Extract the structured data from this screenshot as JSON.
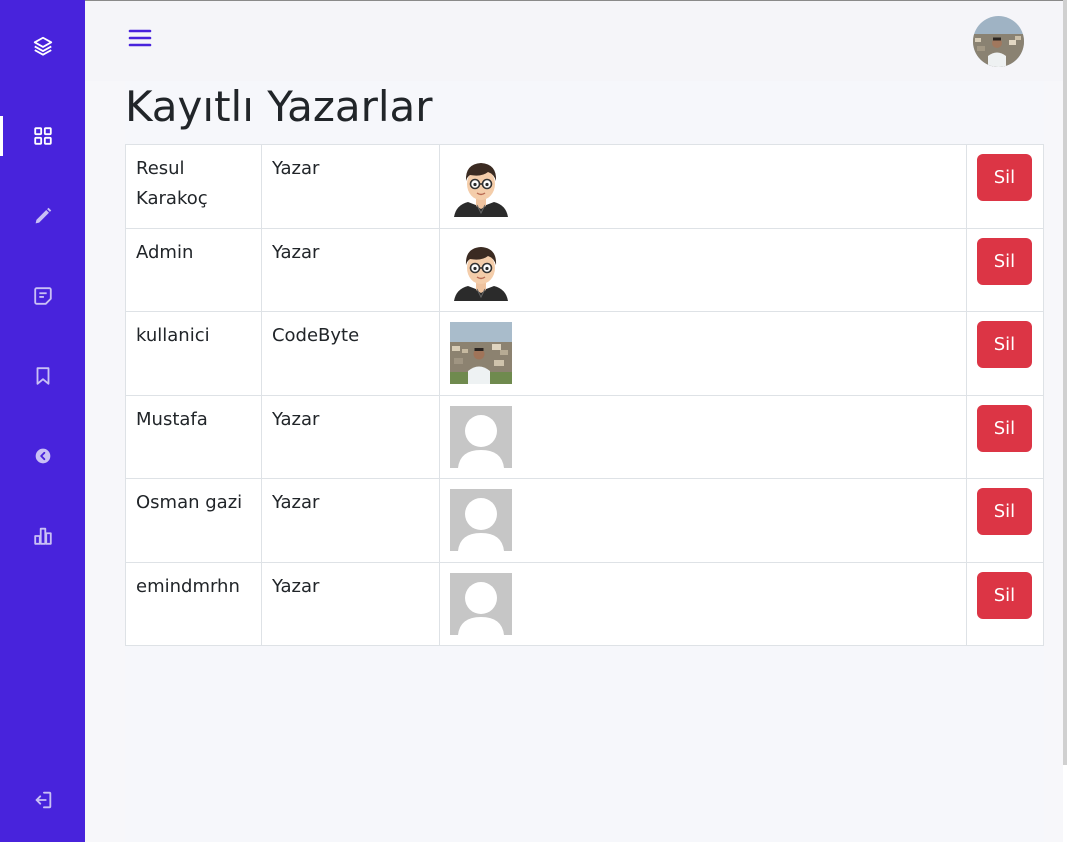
{
  "page": {
    "title": "Kayıtlı Yazarlar"
  },
  "sidebar": {
    "items": [
      {
        "icon": "layers-icon"
      },
      {
        "icon": "grid-icon",
        "active": true
      },
      {
        "icon": "pencil-icon"
      },
      {
        "icon": "note-icon"
      },
      {
        "icon": "bookmark-icon"
      },
      {
        "icon": "arrow-left-circle-icon"
      },
      {
        "icon": "bar-chart-icon"
      },
      {
        "icon": "logout-icon"
      }
    ]
  },
  "topbar": {
    "menu_icon": "hamburger-icon",
    "avatar": "user-avatar"
  },
  "colors": {
    "sidebar": "#4823dc",
    "accent": "#4823dc",
    "danger": "#dc3545"
  },
  "authors": [
    {
      "name": "Resul Karakoç",
      "role": "Yazar",
      "image": "cartoon-avatar",
      "action": "Sil"
    },
    {
      "name": "Admin",
      "role": "Yazar",
      "image": "cartoon-avatar",
      "action": "Sil"
    },
    {
      "name": "kullanici",
      "role": "CodeByte",
      "image": "photo-avatar",
      "action": "Sil"
    },
    {
      "name": "Mustafa",
      "role": "Yazar",
      "image": "placeholder-avatar",
      "action": "Sil"
    },
    {
      "name": "Osman gazi",
      "role": "Yazar",
      "image": "placeholder-avatar",
      "action": "Sil"
    },
    {
      "name": "emindmrhn",
      "role": "Yazar",
      "image": "placeholder-avatar",
      "action": "Sil"
    }
  ]
}
